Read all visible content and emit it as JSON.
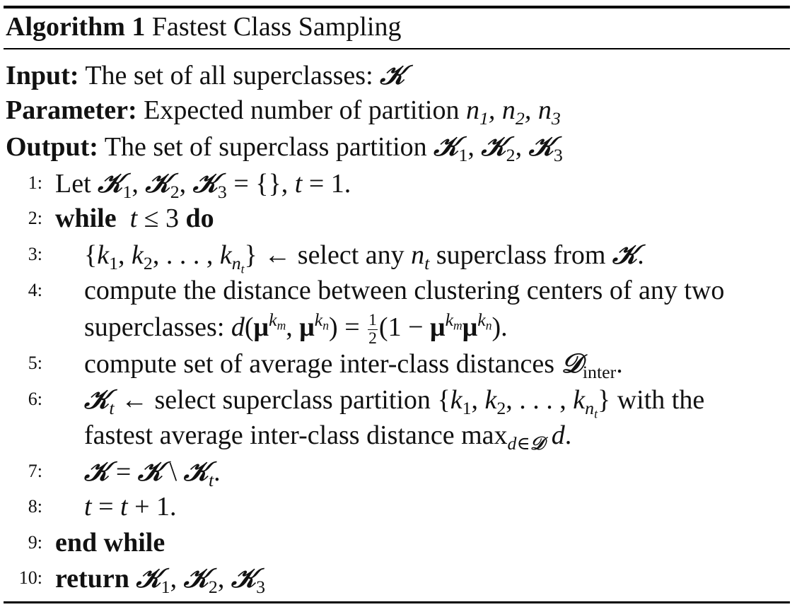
{
  "algorithm": {
    "label": "Algorithm 1",
    "title": "Fastest Class Sampling"
  },
  "io": {
    "input_key": "Input:",
    "input_text": "The set of all superclasses:",
    "parameter_key": "Parameter:",
    "parameter_text": "Expected number of partition",
    "output_key": "Output:",
    "output_text": "The set of superclass partition"
  },
  "symbols": {
    "K": "𝒦",
    "D": "𝒟",
    "mu": "μ"
  },
  "steps": [
    {
      "num": "1:",
      "text": "Let"
    },
    {
      "num": "2:",
      "kw": "while",
      "kw2": "do"
    },
    {
      "num": "3:",
      "text": "select any",
      "text2": "superclass from"
    },
    {
      "num": "4:",
      "text": "compute the distance between clustering centers of any two",
      "text2": "superclasses:"
    },
    {
      "num": "5:",
      "text": "compute set of average inter-class distances",
      "sub": "inter"
    },
    {
      "num": "6:",
      "text": "select superclass partition",
      "text2": "with the",
      "text3": "fastest average inter-class distance max"
    },
    {
      "num": "7:"
    },
    {
      "num": "8:"
    },
    {
      "num": "9:",
      "kw": "end while"
    },
    {
      "num": "10:",
      "kw": "return"
    }
  ]
}
